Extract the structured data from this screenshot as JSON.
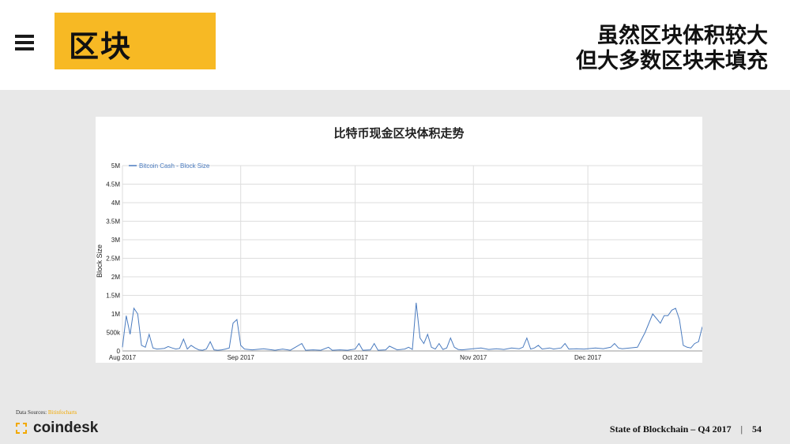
{
  "header": {
    "title": "区块",
    "headline_line1": "虽然区块体积较大",
    "headline_line2": "但大多数区块未填充"
  },
  "footer": {
    "sources_label": "Data Sources:",
    "sources_value": "Bitinfocharts",
    "logo_text": "coindesk",
    "report": "State of Blockchain – Q4 2017",
    "separator": "|",
    "page_number": "54"
  },
  "colors": {
    "accent": "#f7b924",
    "series": "#4a7bbf",
    "content_background": "#e8e8e8"
  },
  "chart_data": {
    "type": "line",
    "title": "比特币现金区块体积走势",
    "ylabel": "Block Size",
    "xlabel": "",
    "legend": "top-left",
    "grid": true,
    "ylim": [
      0,
      5000000
    ],
    "yticks": [
      0,
      500000,
      1000000,
      1500000,
      2000000,
      2500000,
      3000000,
      3500000,
      4000000,
      4500000,
      5000000
    ],
    "ytick_labels": [
      "0",
      "500k",
      "1M",
      "1.5M",
      "2M",
      "2.5M",
      "3M",
      "3.5M",
      "4M",
      "4.5M",
      "5M"
    ],
    "x_start": "2017-08-01",
    "x_end": "2017-12-31",
    "xticks": [
      "2017-08-01",
      "2017-09-01",
      "2017-10-01",
      "2017-11-01",
      "2017-12-01"
    ],
    "xtick_labels": [
      "Aug 2017",
      "Sep 2017",
      "Oct 2017",
      "Nov 2017",
      "Dec 2017"
    ],
    "series": [
      {
        "name": "Bitcoin Cash - Block Size",
        "points": [
          [
            "2017-08-01",
            100000
          ],
          [
            "2017-08-02",
            950000
          ],
          [
            "2017-08-03",
            450000
          ],
          [
            "2017-08-04",
            1150000
          ],
          [
            "2017-08-05",
            1000000
          ],
          [
            "2017-08-06",
            150000
          ],
          [
            "2017-08-07",
            100000
          ],
          [
            "2017-08-08",
            450000
          ],
          [
            "2017-08-09",
            80000
          ],
          [
            "2017-08-10",
            50000
          ],
          [
            "2017-08-11",
            60000
          ],
          [
            "2017-08-12",
            70000
          ],
          [
            "2017-08-13",
            120000
          ],
          [
            "2017-08-14",
            80000
          ],
          [
            "2017-08-15",
            50000
          ],
          [
            "2017-08-16",
            70000
          ],
          [
            "2017-08-17",
            320000
          ],
          [
            "2017-08-18",
            50000
          ],
          [
            "2017-08-19",
            150000
          ],
          [
            "2017-08-20",
            80000
          ],
          [
            "2017-08-21",
            30000
          ],
          [
            "2017-08-22",
            20000
          ],
          [
            "2017-08-23",
            50000
          ],
          [
            "2017-08-24",
            250000
          ],
          [
            "2017-08-25",
            30000
          ],
          [
            "2017-08-26",
            20000
          ],
          [
            "2017-08-27",
            30000
          ],
          [
            "2017-08-28",
            50000
          ],
          [
            "2017-08-29",
            80000
          ],
          [
            "2017-08-30",
            750000
          ],
          [
            "2017-08-31",
            850000
          ],
          [
            "2017-09-01",
            150000
          ],
          [
            "2017-09-02",
            50000
          ],
          [
            "2017-09-04",
            30000
          ],
          [
            "2017-09-07",
            60000
          ],
          [
            "2017-09-10",
            20000
          ],
          [
            "2017-09-12",
            50000
          ],
          [
            "2017-09-14",
            20000
          ],
          [
            "2017-09-17",
            200000
          ],
          [
            "2017-09-18",
            20000
          ],
          [
            "2017-09-20",
            30000
          ],
          [
            "2017-09-22",
            20000
          ],
          [
            "2017-09-24",
            100000
          ],
          [
            "2017-09-25",
            20000
          ],
          [
            "2017-09-27",
            30000
          ],
          [
            "2017-09-29",
            20000
          ],
          [
            "2017-10-01",
            50000
          ],
          [
            "2017-10-02",
            200000
          ],
          [
            "2017-10-03",
            20000
          ],
          [
            "2017-10-05",
            30000
          ],
          [
            "2017-10-06",
            200000
          ],
          [
            "2017-10-07",
            20000
          ],
          [
            "2017-10-09",
            30000
          ],
          [
            "2017-10-10",
            130000
          ],
          [
            "2017-10-12",
            30000
          ],
          [
            "2017-10-14",
            50000
          ],
          [
            "2017-10-15",
            100000
          ],
          [
            "2017-10-16",
            40000
          ],
          [
            "2017-10-17",
            1300000
          ],
          [
            "2017-10-18",
            350000
          ],
          [
            "2017-10-19",
            200000
          ],
          [
            "2017-10-20",
            450000
          ],
          [
            "2017-10-21",
            100000
          ],
          [
            "2017-10-22",
            50000
          ],
          [
            "2017-10-23",
            200000
          ],
          [
            "2017-10-24",
            40000
          ],
          [
            "2017-10-25",
            80000
          ],
          [
            "2017-10-26",
            350000
          ],
          [
            "2017-10-27",
            100000
          ],
          [
            "2017-10-28",
            40000
          ],
          [
            "2017-10-29",
            30000
          ],
          [
            "2017-10-31",
            50000
          ],
          [
            "2017-11-03",
            80000
          ],
          [
            "2017-11-05",
            40000
          ],
          [
            "2017-11-07",
            60000
          ],
          [
            "2017-11-09",
            40000
          ],
          [
            "2017-11-11",
            80000
          ],
          [
            "2017-11-13",
            60000
          ],
          [
            "2017-11-14",
            100000
          ],
          [
            "2017-11-15",
            350000
          ],
          [
            "2017-11-16",
            50000
          ],
          [
            "2017-11-17",
            80000
          ],
          [
            "2017-11-18",
            150000
          ],
          [
            "2017-11-19",
            50000
          ],
          [
            "2017-11-21",
            80000
          ],
          [
            "2017-11-22",
            50000
          ],
          [
            "2017-11-24",
            80000
          ],
          [
            "2017-11-25",
            200000
          ],
          [
            "2017-11-26",
            50000
          ],
          [
            "2017-11-28",
            60000
          ],
          [
            "2017-11-30",
            50000
          ],
          [
            "2017-12-03",
            80000
          ],
          [
            "2017-12-05",
            60000
          ],
          [
            "2017-12-07",
            100000
          ],
          [
            "2017-12-08",
            200000
          ],
          [
            "2017-12-09",
            80000
          ],
          [
            "2017-12-10",
            60000
          ],
          [
            "2017-12-12",
            80000
          ],
          [
            "2017-12-14",
            100000
          ],
          [
            "2017-12-16",
            500000
          ],
          [
            "2017-12-18",
            1000000
          ],
          [
            "2017-12-20",
            750000
          ],
          [
            "2017-12-21",
            950000
          ],
          [
            "2017-12-22",
            950000
          ],
          [
            "2017-12-23",
            1100000
          ],
          [
            "2017-12-24",
            1150000
          ],
          [
            "2017-12-25",
            850000
          ],
          [
            "2017-12-26",
            150000
          ],
          [
            "2017-12-27",
            100000
          ],
          [
            "2017-12-28",
            80000
          ],
          [
            "2017-12-29",
            200000
          ],
          [
            "2017-12-30",
            250000
          ],
          [
            "2017-12-31",
            650000
          ]
        ]
      }
    ]
  }
}
